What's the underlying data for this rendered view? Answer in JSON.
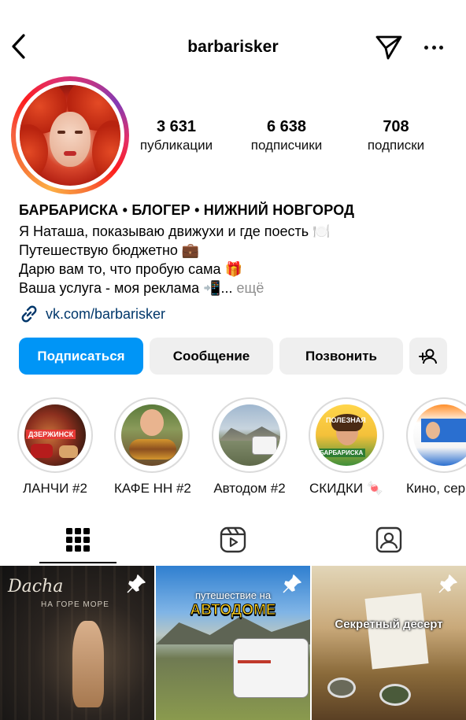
{
  "header": {
    "username": "barbarisker"
  },
  "stats": [
    {
      "value": "3 631",
      "label": "публикации"
    },
    {
      "value": "6 638",
      "label": "подписчики"
    },
    {
      "value": "708",
      "label": "подписки"
    }
  ],
  "bio": {
    "name": "БАРБАРИСКА • БЛОГЕР • НИЖНИЙ НОВГОРОД",
    "lines": [
      "Я Наташа, показываю движухи и где поесть 🍽️",
      "Путешествую бюджетно 💼",
      "Дарю вам то, что пробую сама 🎁",
      "Ваша услуга - моя реклама 📲..."
    ],
    "more": "ещё",
    "link": "vk.com/barbarisker"
  },
  "buttons": {
    "follow": "Подписаться",
    "message": "Сообщение",
    "call": "Позвонить"
  },
  "highlights": [
    {
      "label": "ЛАНЧИ #2",
      "tag": "ДЗЕРЖИНСК"
    },
    {
      "label": "КАФЕ НН #2"
    },
    {
      "label": "Автодом #2"
    },
    {
      "label": "СКИДКИ 🍬",
      "tag": "ПОЛЕЗНАЯ",
      "tag2": "БАРБАРИСКА"
    },
    {
      "label": "Кино, сер"
    }
  ],
  "posts": [
    {
      "caption_top": "Dacha",
      "caption_sub": "НА ГОРЕ МОРЕ"
    },
    {
      "caption_top": "путешествие на",
      "caption_main": "АВТОДОМЕ"
    },
    {
      "caption_main": "Секретный десерт"
    }
  ],
  "colors": {
    "accent": "#0095f6",
    "link": "#00376b",
    "button_bg": "#efefef",
    "muted": "#8e8e8e"
  }
}
